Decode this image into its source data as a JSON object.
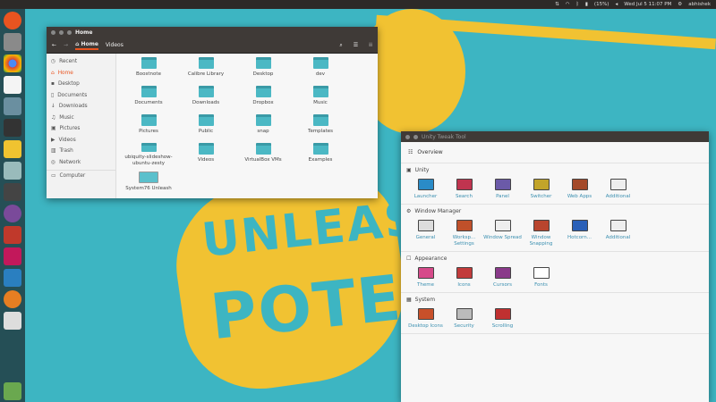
{
  "topbar": {
    "battery": "(15%)",
    "datetime": "Wed Jul 5 11:07 PM",
    "user": "abhishek"
  },
  "poster": {
    "line1": "UNLEASH",
    "line2": "POTEN"
  },
  "file_manager": {
    "title": "Home",
    "breadcrumbs": [
      "Home",
      "Videos"
    ],
    "sidebar": [
      "Recent",
      "Home",
      "Desktop",
      "Documents",
      "Downloads",
      "Music",
      "Pictures",
      "Videos",
      "Trash",
      "Network",
      "Computer"
    ],
    "files": [
      "Boostnote",
      "Calibre Library",
      "Desktop",
      "dev",
      "Documents",
      "Downloads",
      "Dropbox",
      "Music",
      "Pictures",
      "Public",
      "snap",
      "Templates",
      "ubiquity-slideshow-ubuntu-zesty",
      "Videos",
      "VirtualBox VMs",
      "Examples",
      "System76 Unleash"
    ]
  },
  "tweak_tool": {
    "title": "Unity Tweak Tool",
    "overview": "Overview",
    "sections": [
      {
        "title": "Unity",
        "items": [
          "Launcher",
          "Search",
          "Panel",
          "Switcher",
          "Web Apps",
          "Additional"
        ],
        "colors": [
          "#2a8bc7",
          "#c0344f",
          "#6b5aa8",
          "#c2a42a",
          "#a44a2a",
          "#eeeeee"
        ]
      },
      {
        "title": "Window Manager",
        "items": [
          "General",
          "Worksp... Settings",
          "Window Spread",
          "Window Snapping",
          "Hotcorn...",
          "Additional"
        ],
        "colors": [
          "#dddddd",
          "#c0502a",
          "#eeeeee",
          "#b9452e",
          "#2a60b8",
          "#eeeeee"
        ]
      },
      {
        "title": "Appearance",
        "items": [
          "Theme",
          "Icons",
          "Cursors",
          "Fonts"
        ],
        "colors": [
          "#d64a8a",
          "#c23b3b",
          "#8a3a8a",
          "#ffffff"
        ]
      },
      {
        "title": "System",
        "items": [
          "Desktop Icons",
          "Security",
          "Scrolling"
        ],
        "colors": [
          "#c8502a",
          "#bbbbbb",
          "#c03030"
        ]
      }
    ]
  }
}
